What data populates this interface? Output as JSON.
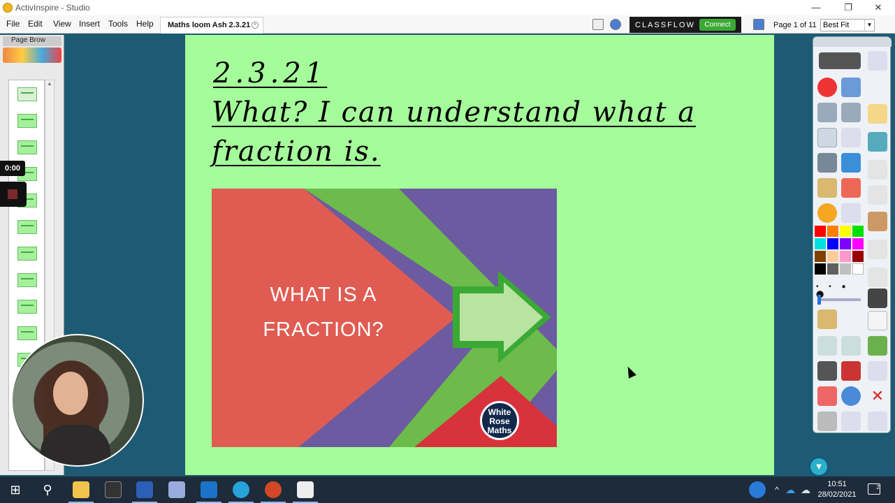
{
  "window": {
    "title": "ActivInspire - Studio",
    "minimize": "—",
    "maximize": "❐",
    "close": "✕"
  },
  "menu": {
    "items": [
      "File",
      "Edit",
      "View",
      "Insert",
      "Tools",
      "Help"
    ],
    "document_tab": "Maths loom Ash 2.3.21",
    "tab_close": "×"
  },
  "classflow": {
    "label": "CLASSFLOW",
    "connect": "Connect"
  },
  "page_indicator": "Page 1 of 11",
  "zoom": {
    "value": "Best Fit",
    "caret": "▼"
  },
  "page_browser": {
    "header": "Page Brow",
    "scroll_up": "▲",
    "thumbnail_count": 11
  },
  "recording": {
    "timer": "0:00"
  },
  "flipchart": {
    "date": "2.3.21",
    "objective_line1": "What?  I  can  understand  what  a",
    "objective_line2": "fraction  is.",
    "image": {
      "heading_line1": "WHAT IS A",
      "heading_line2": "FRACTION?",
      "logo_line1": "White",
      "logo_line2": "Rose",
      "logo_line3": "Maths"
    }
  },
  "toolbox": {
    "palette": [
      "#ff0000",
      "#ff8000",
      "#ffff00",
      "#00e000",
      "#00e0e0",
      "#0000ff",
      "#8000ff",
      "#ff00ff",
      "#804000",
      "#ffcc99",
      "#ff99cc",
      "#990000",
      "#000000",
      "#606060",
      "#c0c0c0",
      "#ffffff"
    ],
    "collapse": "▼"
  },
  "taskbar": {
    "time": "10:51",
    "date": "28/02/2021",
    "notifications": "2"
  }
}
